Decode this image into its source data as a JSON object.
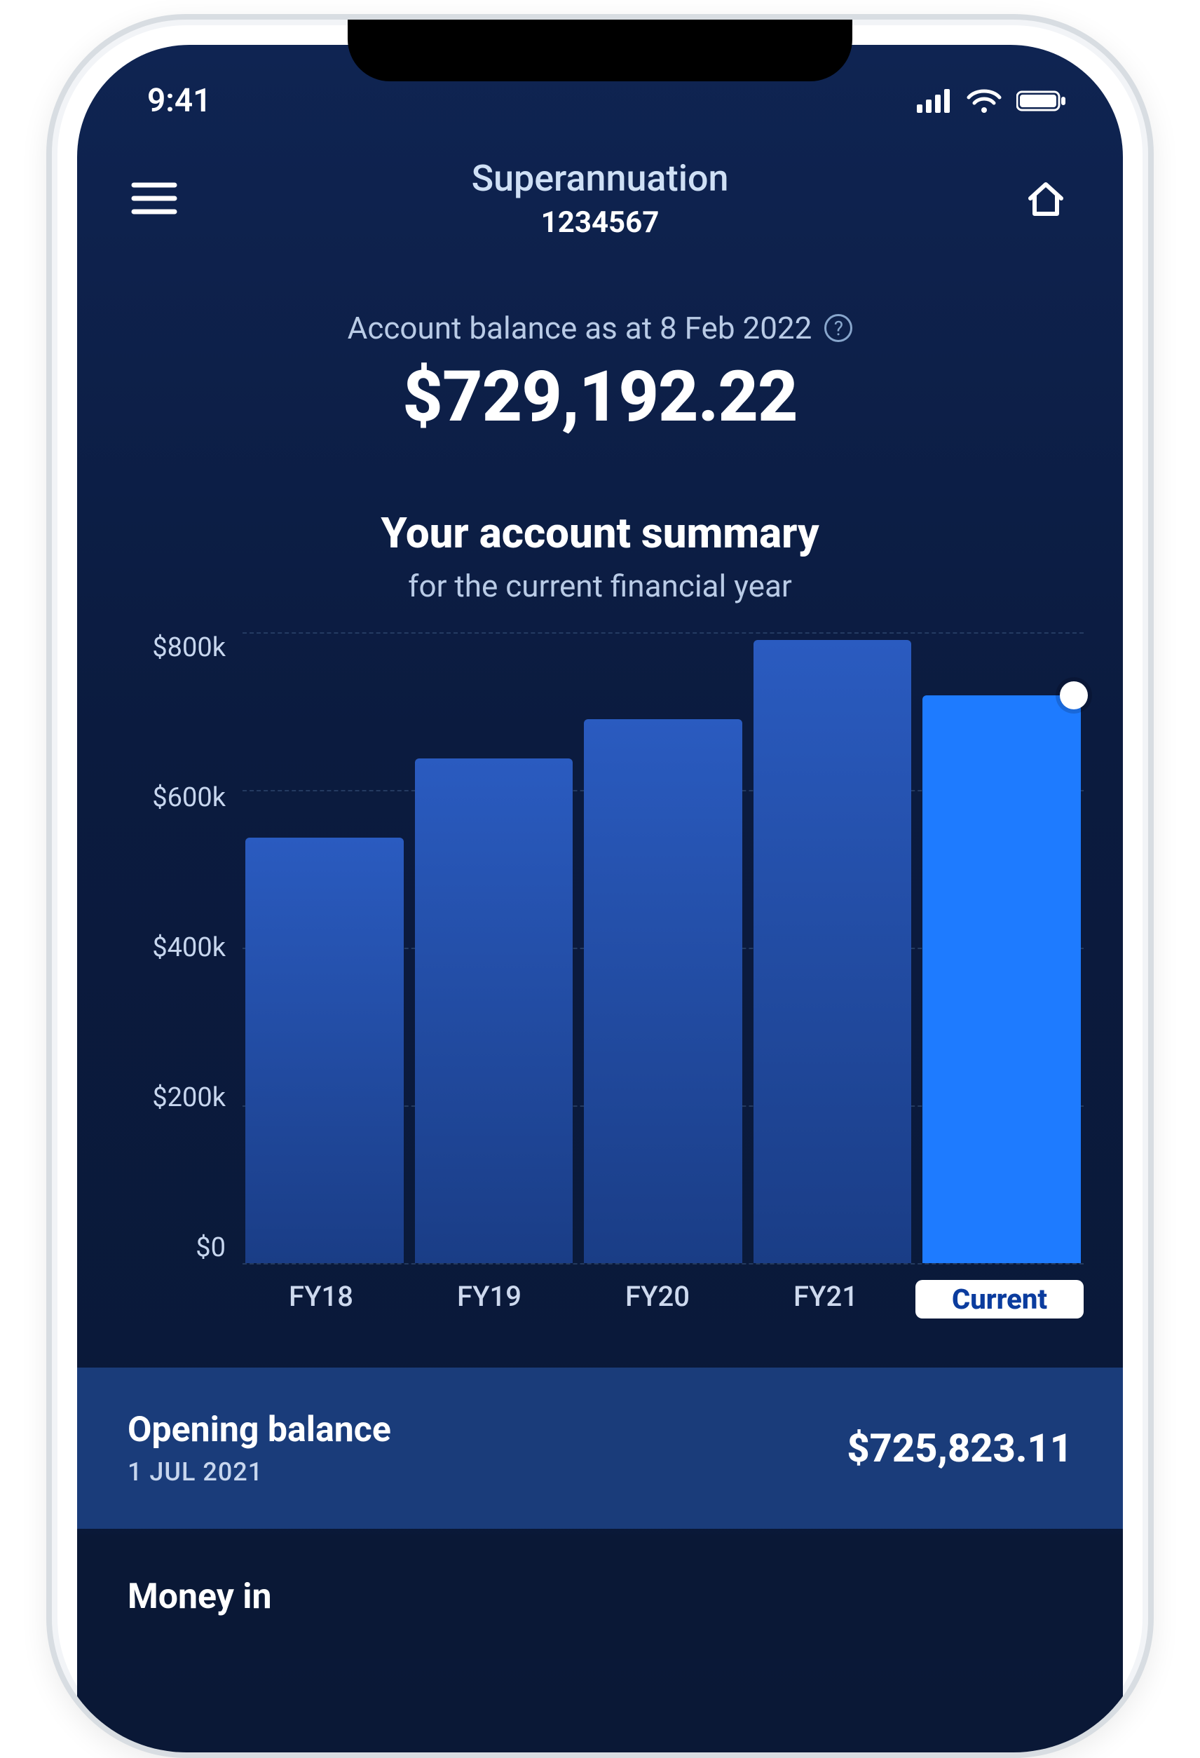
{
  "status": {
    "time": "9:41"
  },
  "header": {
    "title": "Superannuation",
    "account_number": "1234567"
  },
  "balance": {
    "label": "Account balance as at 8 Feb 2022",
    "amount": "$729,192.22"
  },
  "summary": {
    "title": "Your account summary",
    "subtitle": "for the current financial year"
  },
  "chart_data": {
    "type": "bar",
    "categories": [
      "FY18",
      "FY19",
      "FY20",
      "FY21",
      "Current"
    ],
    "values": [
      540,
      640,
      690,
      790,
      720
    ],
    "y_ticks": [
      "$800k",
      "$600k",
      "$400k",
      "$200k",
      "$0"
    ],
    "ylim": [
      0,
      800
    ],
    "current_index": 4,
    "ylabel": "",
    "xlabel": "",
    "title": ""
  },
  "rows": {
    "opening": {
      "label": "Opening balance",
      "date": "1 JUL 2021",
      "value": "$725,823.11"
    },
    "money_in": {
      "label": "Money in"
    }
  }
}
